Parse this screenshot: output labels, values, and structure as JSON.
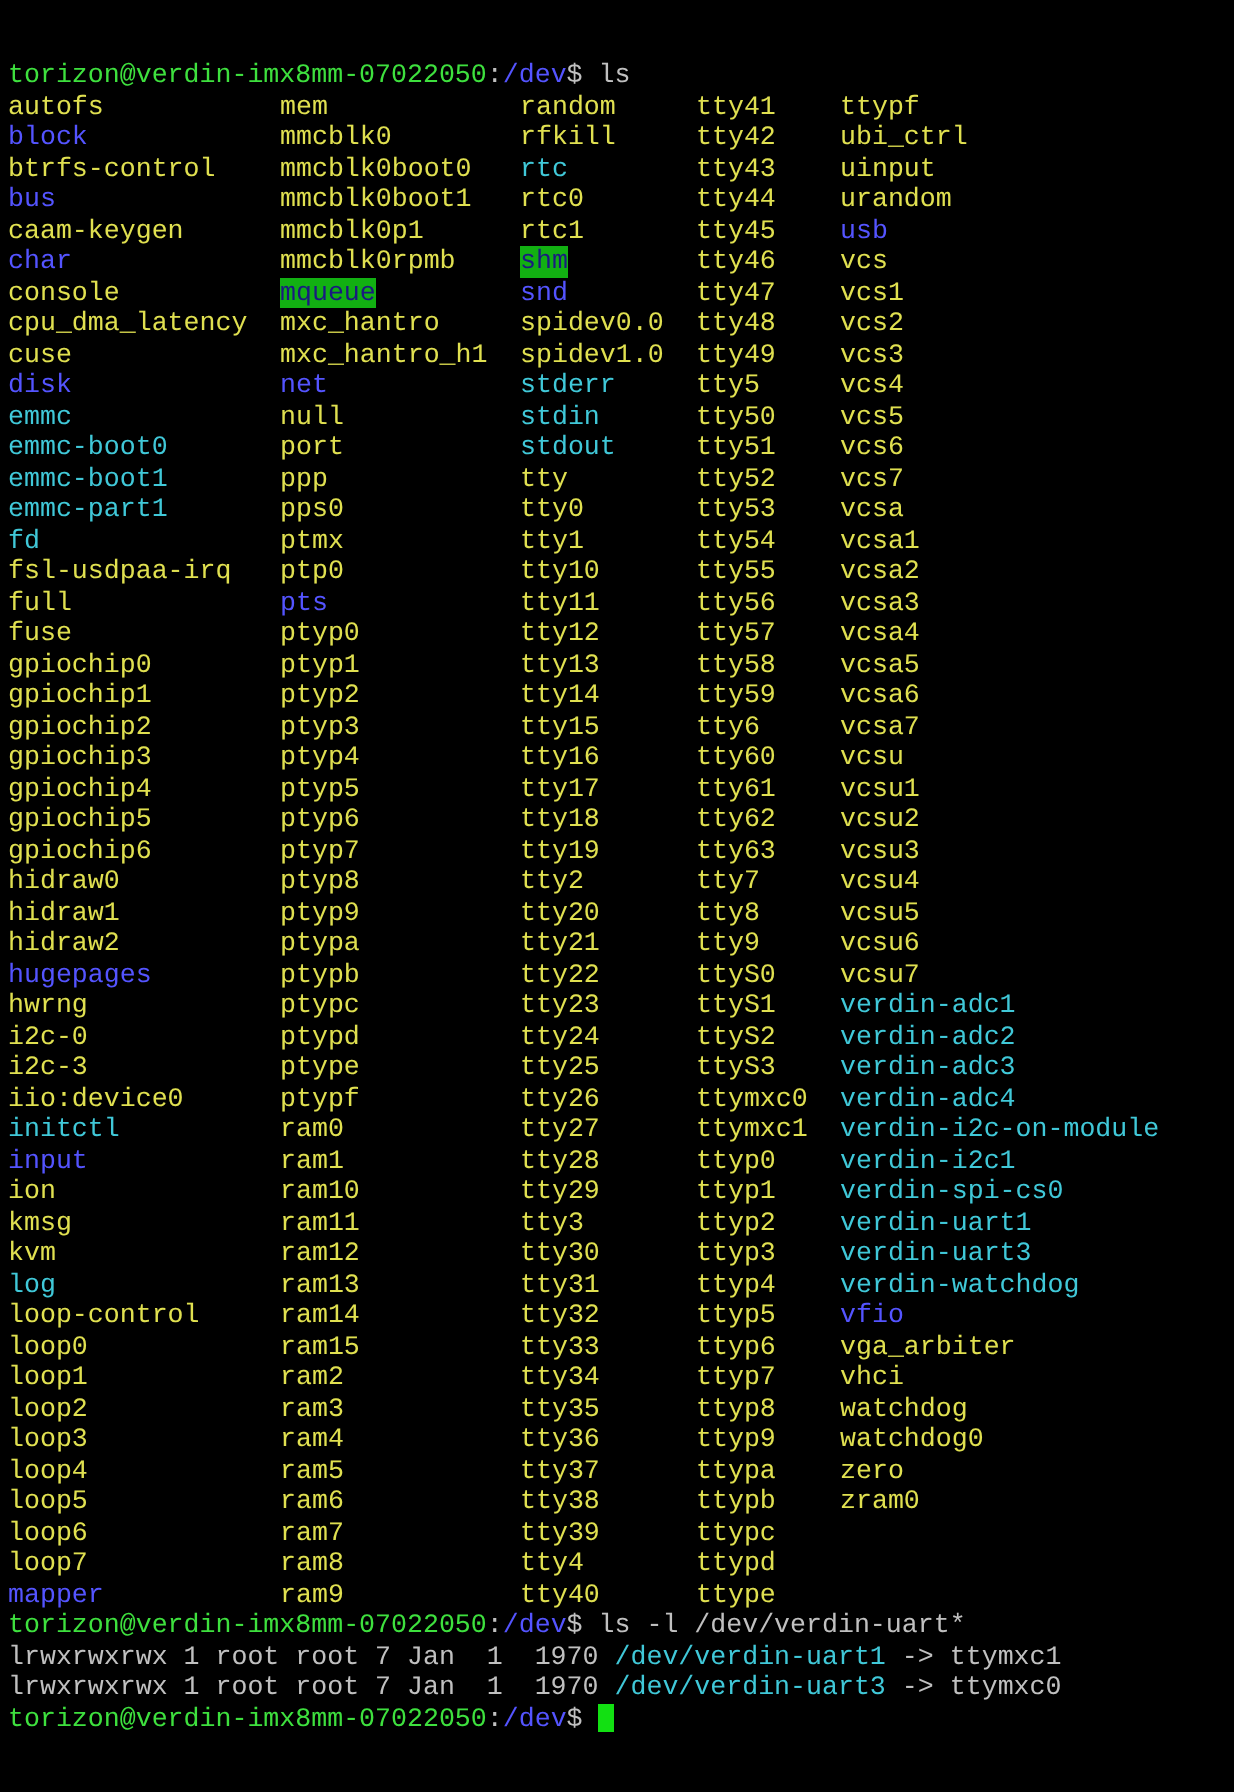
{
  "prompts": [
    {
      "user_host": "torizon@verdin-imx8mm-07022050",
      "separator": ":",
      "path": "/dev",
      "symbol": "$",
      "command": "ls",
      "cursor": false
    },
    {
      "user_host": "torizon@verdin-imx8mm-07022050",
      "separator": ":",
      "path": "/dev",
      "symbol": "$",
      "command": "ls -l /dev/verdin-uart*",
      "cursor": false
    },
    {
      "user_host": "torizon@verdin-imx8mm-07022050",
      "separator": ":",
      "path": "/dev",
      "symbol": "$",
      "cursor": true
    }
  ],
  "listing": {
    "columns": [
      [
        {
          "name": "autofs",
          "kind": "dev"
        },
        {
          "name": "block",
          "kind": "dir"
        },
        {
          "name": "btrfs-control",
          "kind": "dev"
        },
        {
          "name": "bus",
          "kind": "dir"
        },
        {
          "name": "caam-keygen",
          "kind": "dev"
        },
        {
          "name": "char",
          "kind": "dir"
        },
        {
          "name": "console",
          "kind": "dev"
        },
        {
          "name": "cpu_dma_latency",
          "kind": "dev"
        },
        {
          "name": "cuse",
          "kind": "dev"
        },
        {
          "name": "disk",
          "kind": "dir"
        },
        {
          "name": "emmc",
          "kind": "link"
        },
        {
          "name": "emmc-boot0",
          "kind": "link"
        },
        {
          "name": "emmc-boot1",
          "kind": "link"
        },
        {
          "name": "emmc-part1",
          "kind": "link"
        },
        {
          "name": "fd",
          "kind": "link"
        },
        {
          "name": "fsl-usdpaa-irq",
          "kind": "dev"
        },
        {
          "name": "full",
          "kind": "dev"
        },
        {
          "name": "fuse",
          "kind": "dev"
        },
        {
          "name": "gpiochip0",
          "kind": "dev"
        },
        {
          "name": "gpiochip1",
          "kind": "dev"
        },
        {
          "name": "gpiochip2",
          "kind": "dev"
        },
        {
          "name": "gpiochip3",
          "kind": "dev"
        },
        {
          "name": "gpiochip4",
          "kind": "dev"
        },
        {
          "name": "gpiochip5",
          "kind": "dev"
        },
        {
          "name": "gpiochip6",
          "kind": "dev"
        },
        {
          "name": "hidraw0",
          "kind": "dev"
        },
        {
          "name": "hidraw1",
          "kind": "dev"
        },
        {
          "name": "hidraw2",
          "kind": "dev"
        },
        {
          "name": "hugepages",
          "kind": "dir"
        },
        {
          "name": "hwrng",
          "kind": "dev"
        },
        {
          "name": "i2c-0",
          "kind": "dev"
        },
        {
          "name": "i2c-3",
          "kind": "dev"
        },
        {
          "name": "iio:device0",
          "kind": "dev"
        },
        {
          "name": "initctl",
          "kind": "link"
        },
        {
          "name": "input",
          "kind": "dir"
        },
        {
          "name": "ion",
          "kind": "dev"
        },
        {
          "name": "kmsg",
          "kind": "dev"
        },
        {
          "name": "kvm",
          "kind": "dev"
        },
        {
          "name": "log",
          "kind": "link"
        },
        {
          "name": "loop-control",
          "kind": "dev"
        },
        {
          "name": "loop0",
          "kind": "dev"
        },
        {
          "name": "loop1",
          "kind": "dev"
        },
        {
          "name": "loop2",
          "kind": "dev"
        },
        {
          "name": "loop3",
          "kind": "dev"
        },
        {
          "name": "loop4",
          "kind": "dev"
        },
        {
          "name": "loop5",
          "kind": "dev"
        },
        {
          "name": "loop6",
          "kind": "dev"
        },
        {
          "name": "loop7",
          "kind": "dev"
        },
        {
          "name": "mapper",
          "kind": "dir"
        }
      ],
      [
        {
          "name": "mem",
          "kind": "dev"
        },
        {
          "name": "mmcblk0",
          "kind": "dev"
        },
        {
          "name": "mmcblk0boot0",
          "kind": "dev"
        },
        {
          "name": "mmcblk0boot1",
          "kind": "dev"
        },
        {
          "name": "mmcblk0p1",
          "kind": "dev"
        },
        {
          "name": "mmcblk0rpmb",
          "kind": "dev"
        },
        {
          "name": "mqueue",
          "kind": "sticky"
        },
        {
          "name": "mxc_hantro",
          "kind": "dev"
        },
        {
          "name": "mxc_hantro_h1",
          "kind": "dev"
        },
        {
          "name": "net",
          "kind": "dir"
        },
        {
          "name": "null",
          "kind": "dev"
        },
        {
          "name": "port",
          "kind": "dev"
        },
        {
          "name": "ppp",
          "kind": "dev"
        },
        {
          "name": "pps0",
          "kind": "dev"
        },
        {
          "name": "ptmx",
          "kind": "dev"
        },
        {
          "name": "ptp0",
          "kind": "dev"
        },
        {
          "name": "pts",
          "kind": "dir"
        },
        {
          "name": "ptyp0",
          "kind": "dev"
        },
        {
          "name": "ptyp1",
          "kind": "dev"
        },
        {
          "name": "ptyp2",
          "kind": "dev"
        },
        {
          "name": "ptyp3",
          "kind": "dev"
        },
        {
          "name": "ptyp4",
          "kind": "dev"
        },
        {
          "name": "ptyp5",
          "kind": "dev"
        },
        {
          "name": "ptyp6",
          "kind": "dev"
        },
        {
          "name": "ptyp7",
          "kind": "dev"
        },
        {
          "name": "ptyp8",
          "kind": "dev"
        },
        {
          "name": "ptyp9",
          "kind": "dev"
        },
        {
          "name": "ptypa",
          "kind": "dev"
        },
        {
          "name": "ptypb",
          "kind": "dev"
        },
        {
          "name": "ptypc",
          "kind": "dev"
        },
        {
          "name": "ptypd",
          "kind": "dev"
        },
        {
          "name": "ptype",
          "kind": "dev"
        },
        {
          "name": "ptypf",
          "kind": "dev"
        },
        {
          "name": "ram0",
          "kind": "dev"
        },
        {
          "name": "ram1",
          "kind": "dev"
        },
        {
          "name": "ram10",
          "kind": "dev"
        },
        {
          "name": "ram11",
          "kind": "dev"
        },
        {
          "name": "ram12",
          "kind": "dev"
        },
        {
          "name": "ram13",
          "kind": "dev"
        },
        {
          "name": "ram14",
          "kind": "dev"
        },
        {
          "name": "ram15",
          "kind": "dev"
        },
        {
          "name": "ram2",
          "kind": "dev"
        },
        {
          "name": "ram3",
          "kind": "dev"
        },
        {
          "name": "ram4",
          "kind": "dev"
        },
        {
          "name": "ram5",
          "kind": "dev"
        },
        {
          "name": "ram6",
          "kind": "dev"
        },
        {
          "name": "ram7",
          "kind": "dev"
        },
        {
          "name": "ram8",
          "kind": "dev"
        },
        {
          "name": "ram9",
          "kind": "dev"
        }
      ],
      [
        {
          "name": "random",
          "kind": "dev"
        },
        {
          "name": "rfkill",
          "kind": "dev"
        },
        {
          "name": "rtc",
          "kind": "link"
        },
        {
          "name": "rtc0",
          "kind": "dev"
        },
        {
          "name": "rtc1",
          "kind": "dev"
        },
        {
          "name": "shm",
          "kind": "sticky"
        },
        {
          "name": "snd",
          "kind": "dir"
        },
        {
          "name": "spidev0.0",
          "kind": "dev"
        },
        {
          "name": "spidev1.0",
          "kind": "dev"
        },
        {
          "name": "stderr",
          "kind": "link"
        },
        {
          "name": "stdin",
          "kind": "link"
        },
        {
          "name": "stdout",
          "kind": "link"
        },
        {
          "name": "tty",
          "kind": "dev"
        },
        {
          "name": "tty0",
          "kind": "dev"
        },
        {
          "name": "tty1",
          "kind": "dev"
        },
        {
          "name": "tty10",
          "kind": "dev"
        },
        {
          "name": "tty11",
          "kind": "dev"
        },
        {
          "name": "tty12",
          "kind": "dev"
        },
        {
          "name": "tty13",
          "kind": "dev"
        },
        {
          "name": "tty14",
          "kind": "dev"
        },
        {
          "name": "tty15",
          "kind": "dev"
        },
        {
          "name": "tty16",
          "kind": "dev"
        },
        {
          "name": "tty17",
          "kind": "dev"
        },
        {
          "name": "tty18",
          "kind": "dev"
        },
        {
          "name": "tty19",
          "kind": "dev"
        },
        {
          "name": "tty2",
          "kind": "dev"
        },
        {
          "name": "tty20",
          "kind": "dev"
        },
        {
          "name": "tty21",
          "kind": "dev"
        },
        {
          "name": "tty22",
          "kind": "dev"
        },
        {
          "name": "tty23",
          "kind": "dev"
        },
        {
          "name": "tty24",
          "kind": "dev"
        },
        {
          "name": "tty25",
          "kind": "dev"
        },
        {
          "name": "tty26",
          "kind": "dev"
        },
        {
          "name": "tty27",
          "kind": "dev"
        },
        {
          "name": "tty28",
          "kind": "dev"
        },
        {
          "name": "tty29",
          "kind": "dev"
        },
        {
          "name": "tty3",
          "kind": "dev"
        },
        {
          "name": "tty30",
          "kind": "dev"
        },
        {
          "name": "tty31",
          "kind": "dev"
        },
        {
          "name": "tty32",
          "kind": "dev"
        },
        {
          "name": "tty33",
          "kind": "dev"
        },
        {
          "name": "tty34",
          "kind": "dev"
        },
        {
          "name": "tty35",
          "kind": "dev"
        },
        {
          "name": "tty36",
          "kind": "dev"
        },
        {
          "name": "tty37",
          "kind": "dev"
        },
        {
          "name": "tty38",
          "kind": "dev"
        },
        {
          "name": "tty39",
          "kind": "dev"
        },
        {
          "name": "tty4",
          "kind": "dev"
        },
        {
          "name": "tty40",
          "kind": "dev"
        }
      ],
      [
        {
          "name": "tty41",
          "kind": "dev"
        },
        {
          "name": "tty42",
          "kind": "dev"
        },
        {
          "name": "tty43",
          "kind": "dev"
        },
        {
          "name": "tty44",
          "kind": "dev"
        },
        {
          "name": "tty45",
          "kind": "dev"
        },
        {
          "name": "tty46",
          "kind": "dev"
        },
        {
          "name": "tty47",
          "kind": "dev"
        },
        {
          "name": "tty48",
          "kind": "dev"
        },
        {
          "name": "tty49",
          "kind": "dev"
        },
        {
          "name": "tty5",
          "kind": "dev"
        },
        {
          "name": "tty50",
          "kind": "dev"
        },
        {
          "name": "tty51",
          "kind": "dev"
        },
        {
          "name": "tty52",
          "kind": "dev"
        },
        {
          "name": "tty53",
          "kind": "dev"
        },
        {
          "name": "tty54",
          "kind": "dev"
        },
        {
          "name": "tty55",
          "kind": "dev"
        },
        {
          "name": "tty56",
          "kind": "dev"
        },
        {
          "name": "tty57",
          "kind": "dev"
        },
        {
          "name": "tty58",
          "kind": "dev"
        },
        {
          "name": "tty59",
          "kind": "dev"
        },
        {
          "name": "tty6",
          "kind": "dev"
        },
        {
          "name": "tty60",
          "kind": "dev"
        },
        {
          "name": "tty61",
          "kind": "dev"
        },
        {
          "name": "tty62",
          "kind": "dev"
        },
        {
          "name": "tty63",
          "kind": "dev"
        },
        {
          "name": "tty7",
          "kind": "dev"
        },
        {
          "name": "tty8",
          "kind": "dev"
        },
        {
          "name": "tty9",
          "kind": "dev"
        },
        {
          "name": "ttyS0",
          "kind": "dev"
        },
        {
          "name": "ttyS1",
          "kind": "dev"
        },
        {
          "name": "ttyS2",
          "kind": "dev"
        },
        {
          "name": "ttyS3",
          "kind": "dev"
        },
        {
          "name": "ttymxc0",
          "kind": "dev"
        },
        {
          "name": "ttymxc1",
          "kind": "dev"
        },
        {
          "name": "ttyp0",
          "kind": "dev"
        },
        {
          "name": "ttyp1",
          "kind": "dev"
        },
        {
          "name": "ttyp2",
          "kind": "dev"
        },
        {
          "name": "ttyp3",
          "kind": "dev"
        },
        {
          "name": "ttyp4",
          "kind": "dev"
        },
        {
          "name": "ttyp5",
          "kind": "dev"
        },
        {
          "name": "ttyp6",
          "kind": "dev"
        },
        {
          "name": "ttyp7",
          "kind": "dev"
        },
        {
          "name": "ttyp8",
          "kind": "dev"
        },
        {
          "name": "ttyp9",
          "kind": "dev"
        },
        {
          "name": "ttypa",
          "kind": "dev"
        },
        {
          "name": "ttypb",
          "kind": "dev"
        },
        {
          "name": "ttypc",
          "kind": "dev"
        },
        {
          "name": "ttypd",
          "kind": "dev"
        },
        {
          "name": "ttype",
          "kind": "dev"
        }
      ],
      [
        {
          "name": "ttypf",
          "kind": "dev"
        },
        {
          "name": "ubi_ctrl",
          "kind": "dev"
        },
        {
          "name": "uinput",
          "kind": "dev"
        },
        {
          "name": "urandom",
          "kind": "dev"
        },
        {
          "name": "usb",
          "kind": "dir"
        },
        {
          "name": "vcs",
          "kind": "dev"
        },
        {
          "name": "vcs1",
          "kind": "dev"
        },
        {
          "name": "vcs2",
          "kind": "dev"
        },
        {
          "name": "vcs3",
          "kind": "dev"
        },
        {
          "name": "vcs4",
          "kind": "dev"
        },
        {
          "name": "vcs5",
          "kind": "dev"
        },
        {
          "name": "vcs6",
          "kind": "dev"
        },
        {
          "name": "vcs7",
          "kind": "dev"
        },
        {
          "name": "vcsa",
          "kind": "dev"
        },
        {
          "name": "vcsa1",
          "kind": "dev"
        },
        {
          "name": "vcsa2",
          "kind": "dev"
        },
        {
          "name": "vcsa3",
          "kind": "dev"
        },
        {
          "name": "vcsa4",
          "kind": "dev"
        },
        {
          "name": "vcsa5",
          "kind": "dev"
        },
        {
          "name": "vcsa6",
          "kind": "dev"
        },
        {
          "name": "vcsa7",
          "kind": "dev"
        },
        {
          "name": "vcsu",
          "kind": "dev"
        },
        {
          "name": "vcsu1",
          "kind": "dev"
        },
        {
          "name": "vcsu2",
          "kind": "dev"
        },
        {
          "name": "vcsu3",
          "kind": "dev"
        },
        {
          "name": "vcsu4",
          "kind": "dev"
        },
        {
          "name": "vcsu5",
          "kind": "dev"
        },
        {
          "name": "vcsu6",
          "kind": "dev"
        },
        {
          "name": "vcsu7",
          "kind": "dev"
        },
        {
          "name": "verdin-adc1",
          "kind": "link"
        },
        {
          "name": "verdin-adc2",
          "kind": "link"
        },
        {
          "name": "verdin-adc3",
          "kind": "link"
        },
        {
          "name": "verdin-adc4",
          "kind": "link"
        },
        {
          "name": "verdin-i2c-on-module",
          "kind": "link"
        },
        {
          "name": "verdin-i2c1",
          "kind": "link"
        },
        {
          "name": "verdin-spi-cs0",
          "kind": "link"
        },
        {
          "name": "verdin-uart1",
          "kind": "link"
        },
        {
          "name": "verdin-uart3",
          "kind": "link"
        },
        {
          "name": "verdin-watchdog",
          "kind": "link"
        },
        {
          "name": "vfio",
          "kind": "dir"
        },
        {
          "name": "vga_arbiter",
          "kind": "dev"
        },
        {
          "name": "vhci",
          "kind": "dev"
        },
        {
          "name": "watchdog",
          "kind": "dev"
        },
        {
          "name": "watchdog0",
          "kind": "dev"
        },
        {
          "name": "zero",
          "kind": "dev"
        },
        {
          "name": "zram0",
          "kind": "dev"
        }
      ]
    ]
  },
  "long_listing": [
    {
      "info": "lrwxrwxrwx 1 root root 7 Jan  1  1970",
      "path": "/dev/verdin-uart1",
      "arrow": "->",
      "target": "ttymxc1"
    },
    {
      "info": "lrwxrwxrwx 1 root root 7 Jan  1  1970",
      "path": "/dev/verdin-uart3",
      "arrow": "->",
      "target": "ttymxc0"
    }
  ]
}
